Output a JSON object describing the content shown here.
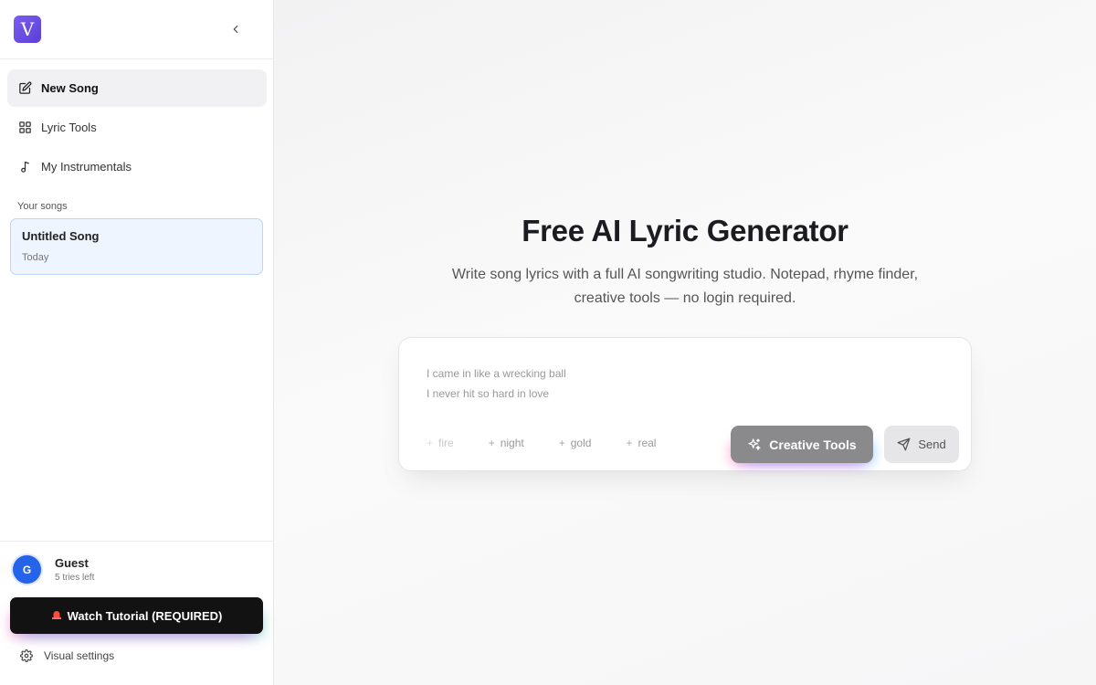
{
  "sidebar": {
    "logo_letter": "V",
    "nav": [
      {
        "label": "New Song",
        "icon": "edit-icon",
        "active": true
      },
      {
        "label": "Lyric Tools",
        "icon": "grid-icon",
        "active": false
      },
      {
        "label": "My Instrumentals",
        "icon": "music-note-icon",
        "active": false
      }
    ],
    "songs_heading": "Your songs",
    "songs": [
      {
        "title": "Untitled Song",
        "date": "Today"
      }
    ],
    "user": {
      "initial": "G",
      "name": "Guest",
      "tries": "5 tries left"
    },
    "tutorial_label": "Watch Tutorial (REQUIRED)",
    "tutorial_icon": "siren-icon",
    "visual_settings_label": "Visual settings"
  },
  "main": {
    "title": "Free AI Lyric Generator",
    "subtitle": "Write song lyrics with a full AI songwriting studio. Notepad, rhyme finder, creative tools — no login required.",
    "composer": {
      "placeholder_line1": "I came in like a wrecking ball",
      "placeholder_line2": "I never hit so hard in love",
      "chips": [
        "fire",
        "night",
        "gold",
        "real"
      ],
      "creative_tools_label": "Creative Tools",
      "send_label": "Send"
    }
  },
  "colors": {
    "accent": "#6d4fe6",
    "avatar": "#2563eb",
    "active_song_bg": "#eef5ff",
    "active_song_border": "#bcd6f5"
  }
}
